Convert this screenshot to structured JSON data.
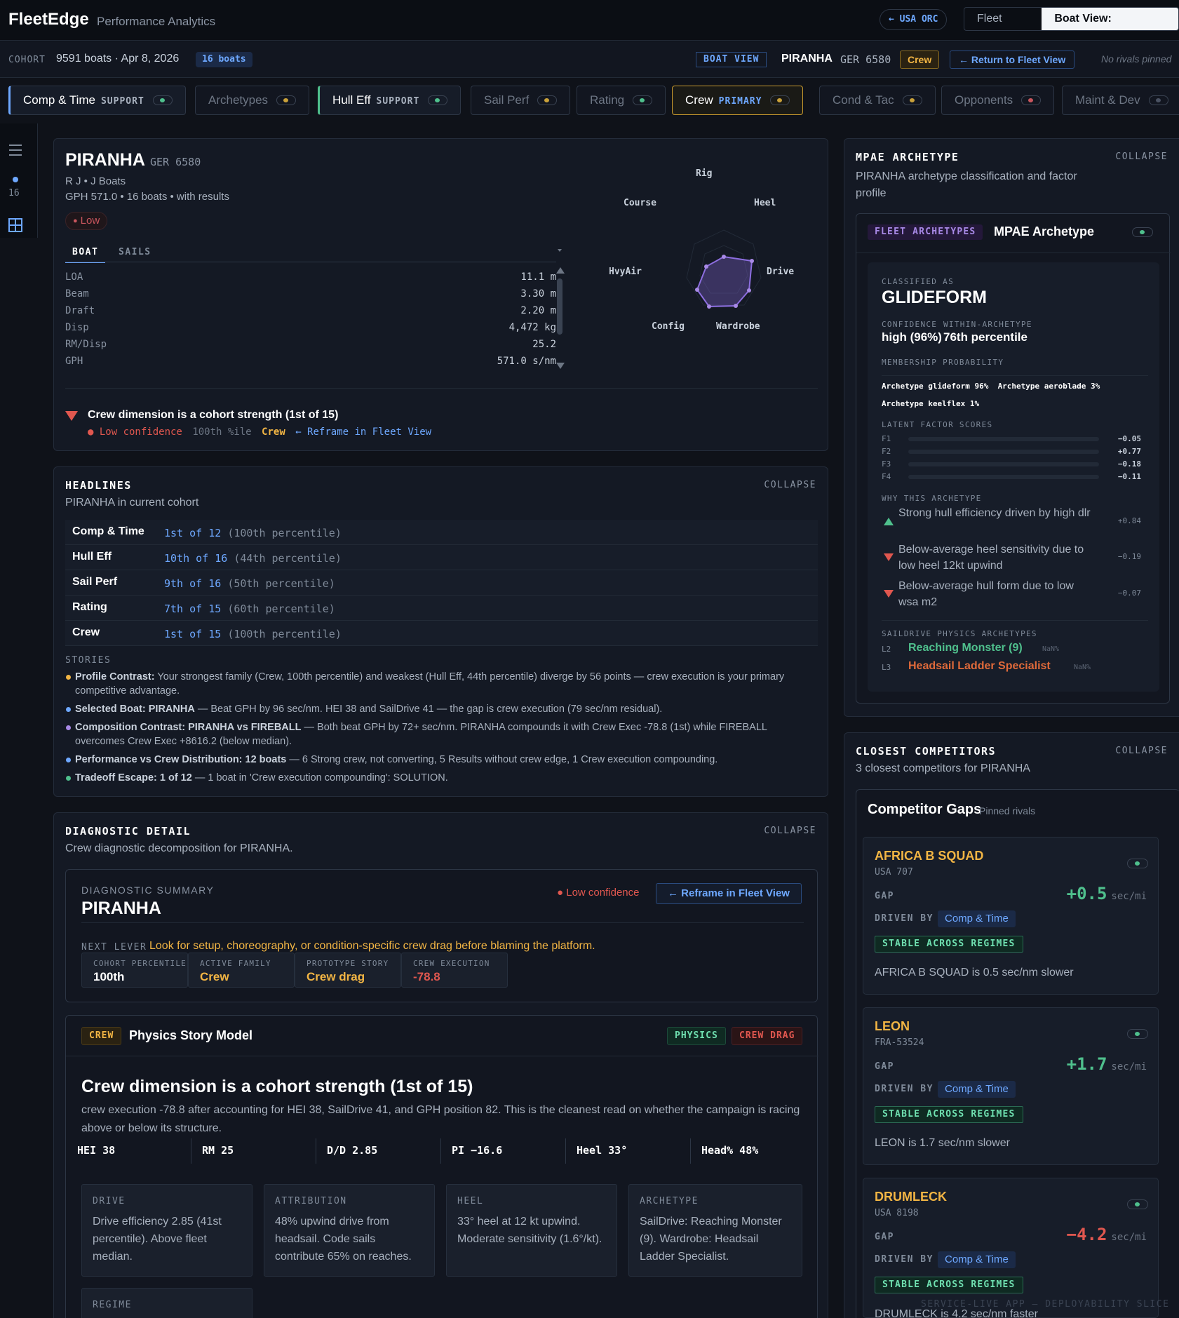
{
  "app": {
    "brand": "FleetEdge",
    "subtitle": "Performance Analytics",
    "orc": "← USA ORC"
  },
  "view_toggle": {
    "fleet": "Fleet View",
    "boat": "Boat View: PIRANHA"
  },
  "cohort": {
    "label": "COHORT",
    "value": "9591 boats · Apr 8, 2026",
    "badge": "16 boats"
  },
  "boat_view": {
    "badge": "BOAT VIEW",
    "name": "PIRANHA",
    "sail": "GER 6580",
    "crew": "Crew",
    "return": "← Return to Fleet View",
    "no_rivals": "No rivals pinned"
  },
  "tabs": [
    {
      "label": "Comp & Time",
      "tag": "SUPPORT",
      "dot": "#4fc08d"
    },
    {
      "label": "Archetypes",
      "tag": "",
      "dot": "#c9a13a"
    },
    {
      "label": "Hull Eff",
      "tag": "SUPPORT",
      "dot": "#4fc08d"
    },
    {
      "label": "Sail Perf",
      "tag": "",
      "dot": "#c9a13a"
    },
    {
      "label": "Rating",
      "tag": "",
      "dot": "#4fc08d"
    },
    {
      "label": "Crew",
      "tag": "PRIMARY",
      "dot": "#c9a13a"
    },
    {
      "label": "Cond & Tac",
      "tag": "",
      "dot": "#c9a13a"
    },
    {
      "label": "Opponents",
      "tag": "",
      "dot": "#c9565e"
    },
    {
      "label": "Maint & Dev",
      "tag": "",
      "dot": "#4a5262"
    }
  ],
  "rail": {
    "count": "16"
  },
  "boat_card": {
    "name": "PIRANHA",
    "sail": "GER 6580",
    "builder": "R J • J Boats",
    "meta": "GPH 571.0 • 16 boats • with results",
    "confidence": "Low",
    "tab_boat": "BOAT",
    "tab_sails": "SAILS",
    "specs": [
      {
        "k": "LOA",
        "v": "11.1 m"
      },
      {
        "k": "Beam",
        "v": "3.30 m"
      },
      {
        "k": "Draft",
        "v": "2.20 m"
      },
      {
        "k": "Disp",
        "v": "4,472 kg"
      },
      {
        "k": "RM/Disp",
        "v": "25.2"
      },
      {
        "k": "GPH",
        "v": "571.0 s/nm"
      }
    ],
    "strength": "Crew dimension is a cohort strength (1st of 15)",
    "conf_low": "Low confidence",
    "conf_pct": "100th %ile",
    "conf_crew": "Crew",
    "conf_reframe": "← Reframe in Fleet View",
    "radar_labels": [
      "Rig",
      "Heel",
      "Drive",
      "Wardrobe",
      "Config",
      "HvyAir",
      "Course"
    ]
  },
  "headlines": {
    "title": "HEADLINES",
    "subtitle": "PIRANHA in current cohort",
    "collapse": "COLLAPSE",
    "rows": [
      {
        "k": "Comp & Time",
        "v": "1st of 12",
        "p": "(100th percentile)"
      },
      {
        "k": "Hull Eff",
        "v": "10th of 16",
        "p": "(44th percentile)"
      },
      {
        "k": "Sail Perf",
        "v": "9th of 16",
        "p": "(50th percentile)"
      },
      {
        "k": "Rating",
        "v": "7th of 15",
        "p": "(60th percentile)"
      },
      {
        "k": "Crew",
        "v": "1st of 15",
        "p": "(100th percentile)"
      }
    ],
    "stories_label": "STORIES",
    "stories": [
      {
        "t": "Profile Contrast:",
        "rest": " Your strongest family (Crew, 100th percentile) and weakest (Hull Eff, 44th percentile) diverge by 56 points — crew execution is your primary competitive advantage.",
        "color": "#f2b544"
      },
      {
        "t": "Selected Boat:",
        "b": " PIRANHA",
        "rest": " — Beat GPH by 96 sec/nm. HEI 38 and SailDrive 41 — the gap is crew execution (79 sec/nm residual).",
        "color": "#6ea8ff"
      },
      {
        "t": "Composition Contrast:",
        "b": " PIRANHA vs FIREBALL",
        "rest": " — Both beat GPH by 72+ sec/nm. PIRANHA compounds it with Crew Exec -78.8 (1st) while FIREBALL overcomes Crew Exec +8616.2 (below median).",
        "color": "#a889e6"
      },
      {
        "t": "Performance vs Crew Distribution:",
        "b": " 12 boats",
        "rest": " — 6 Strong crew, not converting, 5 Results without crew edge, 1 Crew execution compounding.",
        "color": "#6ea8ff"
      },
      {
        "t": "Tradeoff Escape:",
        "b": " 1 of 12",
        "rest": " — 1 boat in 'Crew execution compounding': SOLUTION.",
        "color": "#4fc08d"
      }
    ]
  },
  "diagnostic": {
    "title": "DIAGNOSTIC DETAIL",
    "subtitle": "Crew diagnostic decomposition for PIRANHA.",
    "collapse": "COLLAPSE",
    "summary_label": "DIAGNOSTIC SUMMARY",
    "summary_name": "PIRANHA",
    "low_conf": "Low confidence",
    "reframe": "← Reframe in Fleet View",
    "next_lever_label": "NEXT LEVER",
    "next_lever": "Look for setup, choreography, or condition-specific crew drag before blaming the platform.",
    "metrics": [
      {
        "l": "COHORT PERCENTILE",
        "v": "100th",
        "c": "#ffffff"
      },
      {
        "l": "ACTIVE FAMILY",
        "v": "Crew",
        "c": "#f2b544"
      },
      {
        "l": "PROTOTYPE STORY",
        "v": "Crew drag",
        "c": "#f2b544"
      },
      {
        "l": "CREW EXECUTION",
        "v": "-78.8",
        "c": "#e0574f"
      }
    ],
    "model_chip": "CREW",
    "model_title": "Physics Story Model",
    "physics_badge": "PHYSICS",
    "drag_badge": "CREW DRAG",
    "headline": "Crew dimension is a cohort strength (1st of 15)",
    "body": "crew execution -78.8 after accounting for HEI 38, SailDrive 41, and GPH position 82. This is the cleanest read on whether the campaign is racing above or below its structure.",
    "stats": [
      "HEI 38",
      "RM 25",
      "D/D 2.85",
      "PI −16.6",
      "Heel 33°",
      "Head% 48%"
    ],
    "boxes": [
      {
        "l": "DRIVE",
        "v": "Drive efficiency 2.85 (41st percentile). Above fleet median."
      },
      {
        "l": "ATTRIBUTION",
        "v": "48% upwind drive from headsail. Code sails contribute 65% on reaches."
      },
      {
        "l": "HEEL",
        "v": "33° heel at 12 kt upwind. Moderate sensitivity (1.6°/kt)."
      },
      {
        "l": "ARCHETYPE",
        "v": "SailDrive: Reaching Monster (9). Wardrobe: Headsail Ladder Specialist."
      }
    ],
    "regime_label": "REGIME"
  },
  "archetype": {
    "title": "MPAE ARCHETYPE",
    "subtitle": "PIRANHA archetype classification and factor profile",
    "collapse": "COLLAPSE",
    "chip": "FLEET ARCHETYPES",
    "card_title": "MPAE Archetype",
    "classified_label": "CLASSIFIED AS",
    "classified": "GLIDEFORM",
    "confidence_label": "CONFIDENCE",
    "confidence": "high (96%)",
    "within_label": "WITHIN-ARCHETYPE",
    "within": "76th percentile",
    "membership_label": "MEMBERSHIP PROBABILITY",
    "membership_1": "Archetype glideform 96%  Archetype aeroblade 3%",
    "membership_2": "Archetype keelflex 1%",
    "latent_label": "LATENT FACTOR SCORES",
    "factors": [
      {
        "f": "F1",
        "v": "−0.05"
      },
      {
        "f": "F2",
        "v": "+0.77"
      },
      {
        "f": "F3",
        "v": "−0.18"
      },
      {
        "f": "F4",
        "v": "−0.11"
      }
    ],
    "why_label": "WHY THIS ARCHETYPE",
    "why": [
      {
        "t": "Strong hull efficiency driven by high dlr",
        "s": "+0.84",
        "dir": "up"
      },
      {
        "t": "Below-average heel sensitivity due to low heel 12kt upwind",
        "s": "−0.19",
        "dir": "down"
      },
      {
        "t": "Below-average hull form due to low wsa m2",
        "s": "−0.07",
        "dir": "down"
      }
    ],
    "saildrive_label": "SAILDRIVE PHYSICS ARCHETYPES",
    "l2": "L2",
    "l2_name": "Reaching Monster (9)",
    "l2_nan": "NaN%",
    "l3": "L3",
    "l3_name": "Headsail Ladder Specialist",
    "l3_nan": "NaN%"
  },
  "competitors": {
    "title": "CLOSEST COMPETITORS",
    "subtitle": "3 closest competitors for PIRANHA",
    "collapse": "COLLAPSE",
    "card_title": "Competitor Gaps",
    "card_sub": "Pinned rivals",
    "gap_label": "GAP",
    "driven_label": "DRIVEN BY",
    "stable": "STABLE ACROSS REGIMES",
    "unit": "sec/mi",
    "items": [
      {
        "name": "AFRICA B SQUAD",
        "sail": "USA 707",
        "gap": "+0.5",
        "gap_color": "#4fc08d",
        "driven": "Comp & Time",
        "summary": "AFRICA B SQUAD is 0.5 sec/nm slower"
      },
      {
        "name": "LEON",
        "sail": "FRA-53524",
        "gap": "+1.7",
        "gap_color": "#4fc08d",
        "driven": "Comp & Time",
        "summary": "LEON is 1.7 sec/nm slower"
      },
      {
        "name": "DRUMLECK",
        "sail": "USA 8198",
        "gap": "−4.2",
        "gap_color": "#e0574f",
        "driven": "Comp & Time",
        "summary": "DRUMLECK is 4.2 sec/nm faster"
      }
    ]
  },
  "watermark": "SERVICE-LIVE APP — DEPLOYABILITY SLICE",
  "colors": {
    "accent": "#6ea8ff",
    "amber": "#f2b544",
    "green": "#4fc08d",
    "red": "#e0574f",
    "purple": "#a889e6"
  }
}
